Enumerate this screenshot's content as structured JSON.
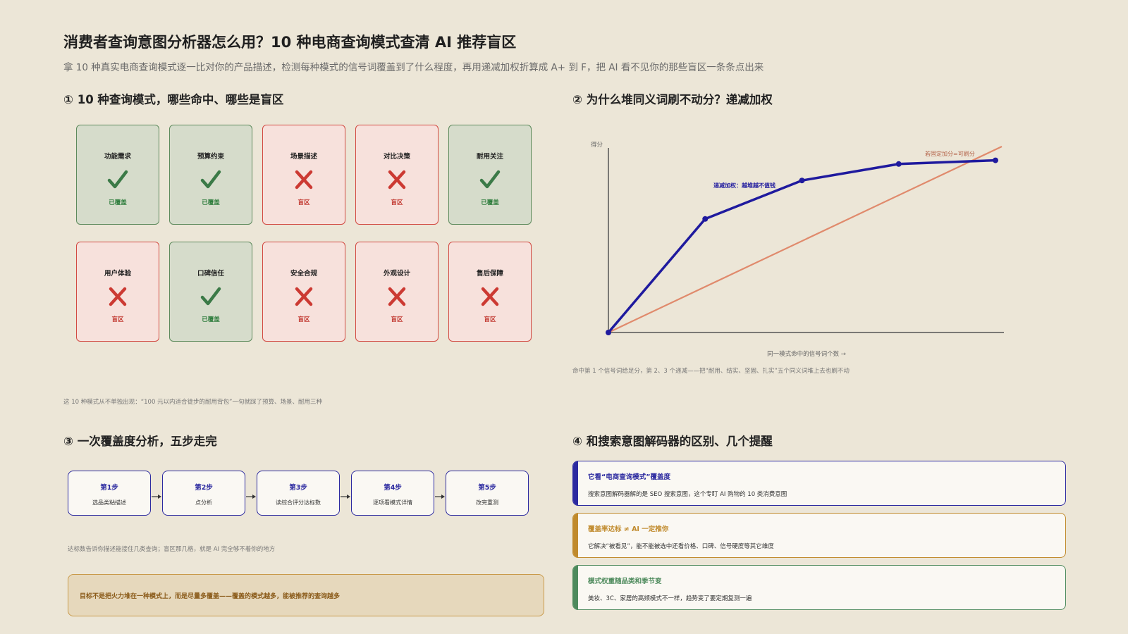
{
  "header": {
    "title": "消费者查询意图分析器怎么用？10 种电商查询模式查清 AI 推荐盲区",
    "subtitle": "拿 10 种真实电商查询模式逐一比对你的产品描述，检测每种模式的信号词覆盖到了什么程度，再用递减加权折算成 A+ 到 F，把 AI 看不见你的那些盲区一条条点出来"
  },
  "section1": {
    "title": "① 10 种查询模式，哪些命中、哪些是盲区",
    "covered_label": "已覆盖",
    "blind_label": "盲区",
    "patterns": [
      {
        "name": "功能需求",
        "covered": true
      },
      {
        "name": "预算约束",
        "covered": true
      },
      {
        "name": "场景描述",
        "covered": false
      },
      {
        "name": "对比决策",
        "covered": false
      },
      {
        "name": "耐用关注",
        "covered": true
      },
      {
        "name": "用户体验",
        "covered": false
      },
      {
        "name": "口碑信任",
        "covered": true
      },
      {
        "name": "安全合规",
        "covered": false
      },
      {
        "name": "外观设计",
        "covered": false
      },
      {
        "name": "售后保障",
        "covered": false
      }
    ],
    "footnote": "这 10 种模式从不单独出现：“100 元以内适合徒步的耐用背包”一句就踩了预算、场景、耐用三种"
  },
  "section2": {
    "title": "② 为什么堆同义词刷不动分？递减加权",
    "chart_data": {
      "type": "line",
      "ylabel": "得分",
      "xlabel": "同一模式命中的信号词个数 →",
      "series": [
        {
          "label": "递减加权：越堆越不值钱",
          "color": "#1f1a9e",
          "points": [
            [
              0,
              0
            ],
            [
              1,
              0.62
            ],
            [
              2,
              0.83
            ],
            [
              3,
              0.92
            ],
            [
              4,
              0.94
            ]
          ]
        },
        {
          "label": "若固定加分=可刷分",
          "color": "#e08a6c",
          "points": [
            [
              0,
              0
            ],
            [
              4,
              1.0
            ]
          ]
        }
      ],
      "xlim": [
        0,
        4
      ],
      "ylim": [
        0,
        1
      ]
    },
    "caption": "命中第 1 个信号词给足分，第 2、3 个递减——把“耐用、结实、坚固、扎实”五个同义词堆上去也刷不动"
  },
  "section3": {
    "title": "③ 一次覆盖度分析，五步走完",
    "steps": [
      {
        "label": "第1步",
        "desc": "选品类粘描述"
      },
      {
        "label": "第2步",
        "desc": "点分析"
      },
      {
        "label": "第3步",
        "desc": "读综合评分达标数"
      },
      {
        "label": "第4步",
        "desc": "逐项看模式详情"
      },
      {
        "label": "第5步",
        "desc": "改完重测"
      }
    ],
    "note": "达标数告诉你描述能接住几类查询；盲区那几格，就是 AI 完全够不着你的地方",
    "callout": "目标不是把火力堆在一种模式上，而是尽量多覆盖——覆盖的模式越多，能被推荐的查询越多"
  },
  "section4": {
    "title": "④ 和搜索意图解码器的区别、几个提醒",
    "tips": [
      {
        "title": "它看“电商查询模式”覆盖度",
        "desc": "搜索意图解码器解的是 SEO 搜索意图，这个专盯 AI 购物的 10 类消费意图",
        "color": "#2c2aa0"
      },
      {
        "title": "覆盖率达标 ≠ AI 一定推你",
        "desc": "它解决“被看见”，能不能被选中还看价格、口碑、信号硬度等其它维度",
        "color": "#c08a2c"
      },
      {
        "title": "模式权重随品类和季节变",
        "desc": "美妆、3C、家居的高频模式不一样，趋势变了要定期复测一遍",
        "color": "#4d8a5c"
      }
    ]
  }
}
